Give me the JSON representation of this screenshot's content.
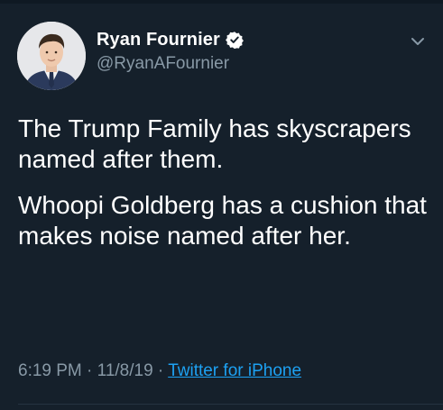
{
  "tweet": {
    "author": {
      "display_name": "Ryan Fournier",
      "handle": "@RyanAFournier",
      "verified": true,
      "avatar_icon": "profile-photo"
    },
    "menu_icon": "chevron-down-icon",
    "body": [
      "The Trump Family has skyscrapers named after them.",
      "Whoopi Goldberg has a cushion that makes noise named after her."
    ],
    "time": "6:19 PM",
    "date": "11/8/19",
    "separator": "·",
    "source": "Twitter for iPhone"
  },
  "colors": {
    "background": "#15202b",
    "text_primary": "#ffffff",
    "text_secondary": "#8899a6",
    "accent": "#1da1f2"
  }
}
